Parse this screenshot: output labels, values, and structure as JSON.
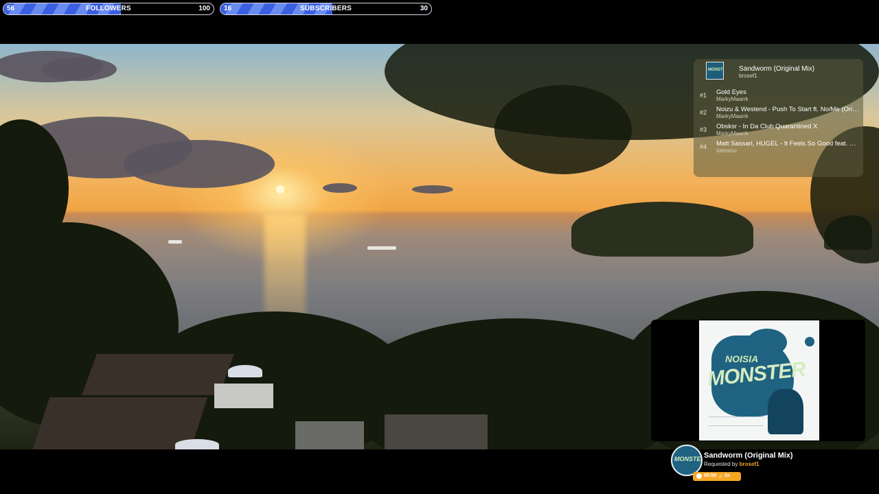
{
  "goals": {
    "followers": {
      "current": "56",
      "label": "FOLLOWERS",
      "target": "100",
      "progress": 0.56
    },
    "subscribers": {
      "current": "16",
      "label": "SUBSCRIBERS",
      "target": "30",
      "progress": 0.53
    }
  },
  "queue": {
    "now_playing": {
      "title": "Sandworm (Original Mix)",
      "requester": "brosef1"
    },
    "items": [
      {
        "rank": "#1",
        "title": "Gold Eyes",
        "artist": "MarkyMaarrk"
      },
      {
        "rank": "#2",
        "title": "Noizu & Westend - Push To Start ft. No/Me (Original Mix)",
        "artist": "MarkyMaarrk"
      },
      {
        "rank": "#3",
        "title": "Obsksr - In Da Club Quarantined X",
        "artist": "MarkyMaarrk"
      },
      {
        "rank": "#4",
        "title": "Matt Sassari, HUGEL - It Feels So Good feat. Sonique",
        "artist": "dalewuu"
      }
    ]
  },
  "album": {
    "line1": "NOISIA",
    "line2": "MONSTER"
  },
  "now_playing": {
    "title": "Sandworm (Original Mix)",
    "requested_prefix": "Requested by",
    "requester": "brosef1",
    "time": "00:59",
    "note_icon": "music-note-icon",
    "count": "3x"
  },
  "colors": {
    "accent": "#f5a623",
    "goal_fill": "#3a5fe0"
  }
}
